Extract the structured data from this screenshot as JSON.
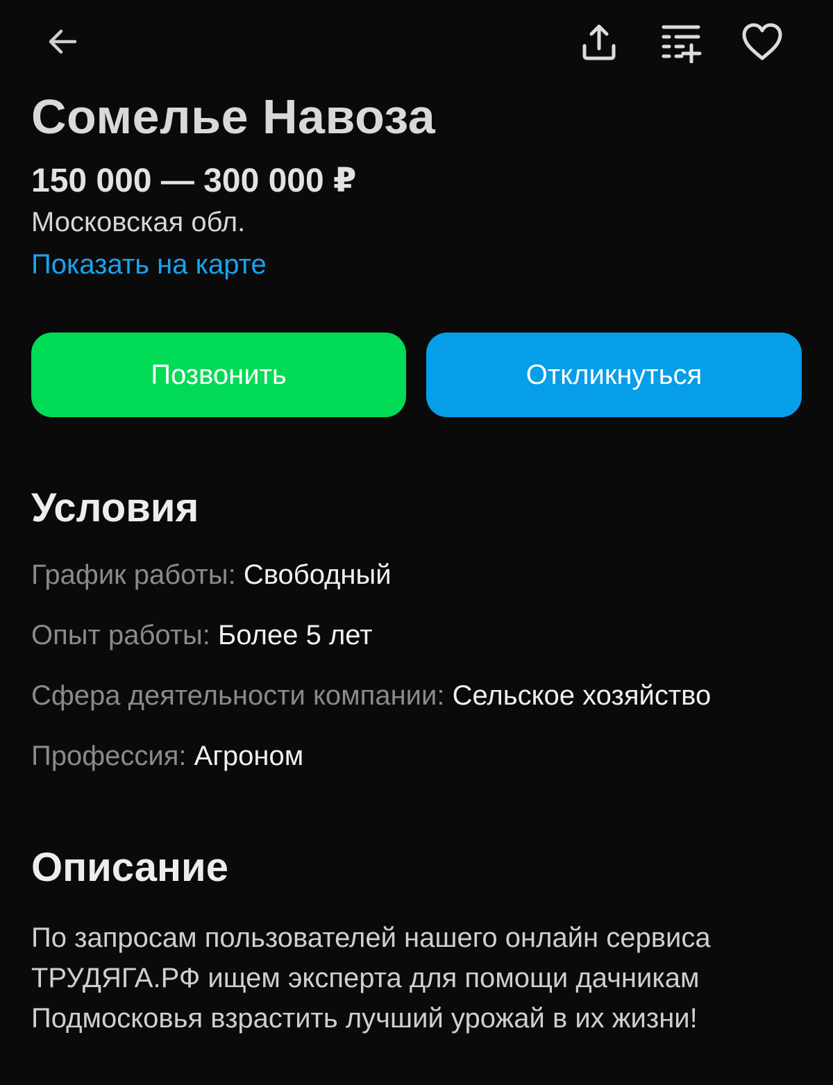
{
  "header": {
    "back_icon": "arrow-left-icon",
    "share_icon": "share-upload-icon",
    "compare_icon": "list-add-icon",
    "favorite_icon": "heart-outline-icon"
  },
  "vacancy": {
    "title": "Сомелье Навоза",
    "salary": "150 000 — 300 000 ₽",
    "region": "Московская обл.",
    "map_link": "Показать на карте"
  },
  "actions": {
    "call_label": "Позвонить",
    "respond_label": "Откликнуться",
    "call_color": "#02db55",
    "respond_color": "#069ee8"
  },
  "conditions": {
    "title": "Условия",
    "rows": [
      {
        "label": "График работы:",
        "value": "Свободный"
      },
      {
        "label": "Опыт работы:",
        "value": "Более 5 лет"
      },
      {
        "label": "Сфера деятельности компании:",
        "value": "Сельское хозяйство"
      },
      {
        "label": "Профессия:",
        "value": "Агроном"
      }
    ]
  },
  "description": {
    "title": "Описание",
    "lines": [
      "По запросам пользователей нашего онлайн сервиса",
      "ТРУДЯГА.РФ ищем эксперта для помощи дачникам",
      "Подмосковья взрастить лучший урожай в их жизни!"
    ]
  },
  "theme": {
    "background": "#0a0a0a",
    "link_color": "#17a4f0"
  }
}
